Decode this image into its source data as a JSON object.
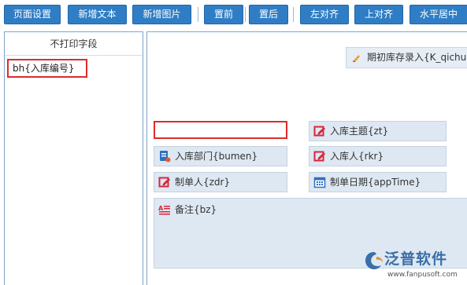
{
  "toolbar": {
    "buttons": [
      {
        "label": "页面设置"
      },
      {
        "label": "新增文本"
      },
      {
        "label": "新增图片"
      },
      {
        "label": "置前"
      },
      {
        "label": "置后"
      },
      {
        "label": "左对齐"
      },
      {
        "label": "上对齐"
      },
      {
        "label": "水平居中"
      }
    ]
  },
  "left_panel": {
    "header": "不打印字段",
    "fields": [
      {
        "label": "bh{入库编号}"
      }
    ]
  },
  "canvas": {
    "title_field": {
      "label": "期初库存录入{K_qichu",
      "icon": "pencil-icon"
    },
    "fields": [
      {
        "label": "入库主题{zt}",
        "icon": "edit-icon"
      },
      {
        "label": "入库部门{bumen}",
        "icon": "document-icon"
      },
      {
        "label": "入库人{rkr}",
        "icon": "edit-icon"
      },
      {
        "label": "制单人{zdr}",
        "icon": "edit-icon"
      },
      {
        "label": "制单日期{appTime}",
        "icon": "calendar-icon"
      },
      {
        "label": "备注{bz}",
        "icon": "textarea-icon"
      }
    ]
  },
  "watermark": {
    "brand": "泛普软件",
    "url": "www.fanpusoft.com"
  },
  "colors": {
    "toolbar_button": "#2f7ec5",
    "selection_border": "#e02a2a",
    "field_background": "#dde8f2",
    "panel_border": "#7fa4c9"
  }
}
